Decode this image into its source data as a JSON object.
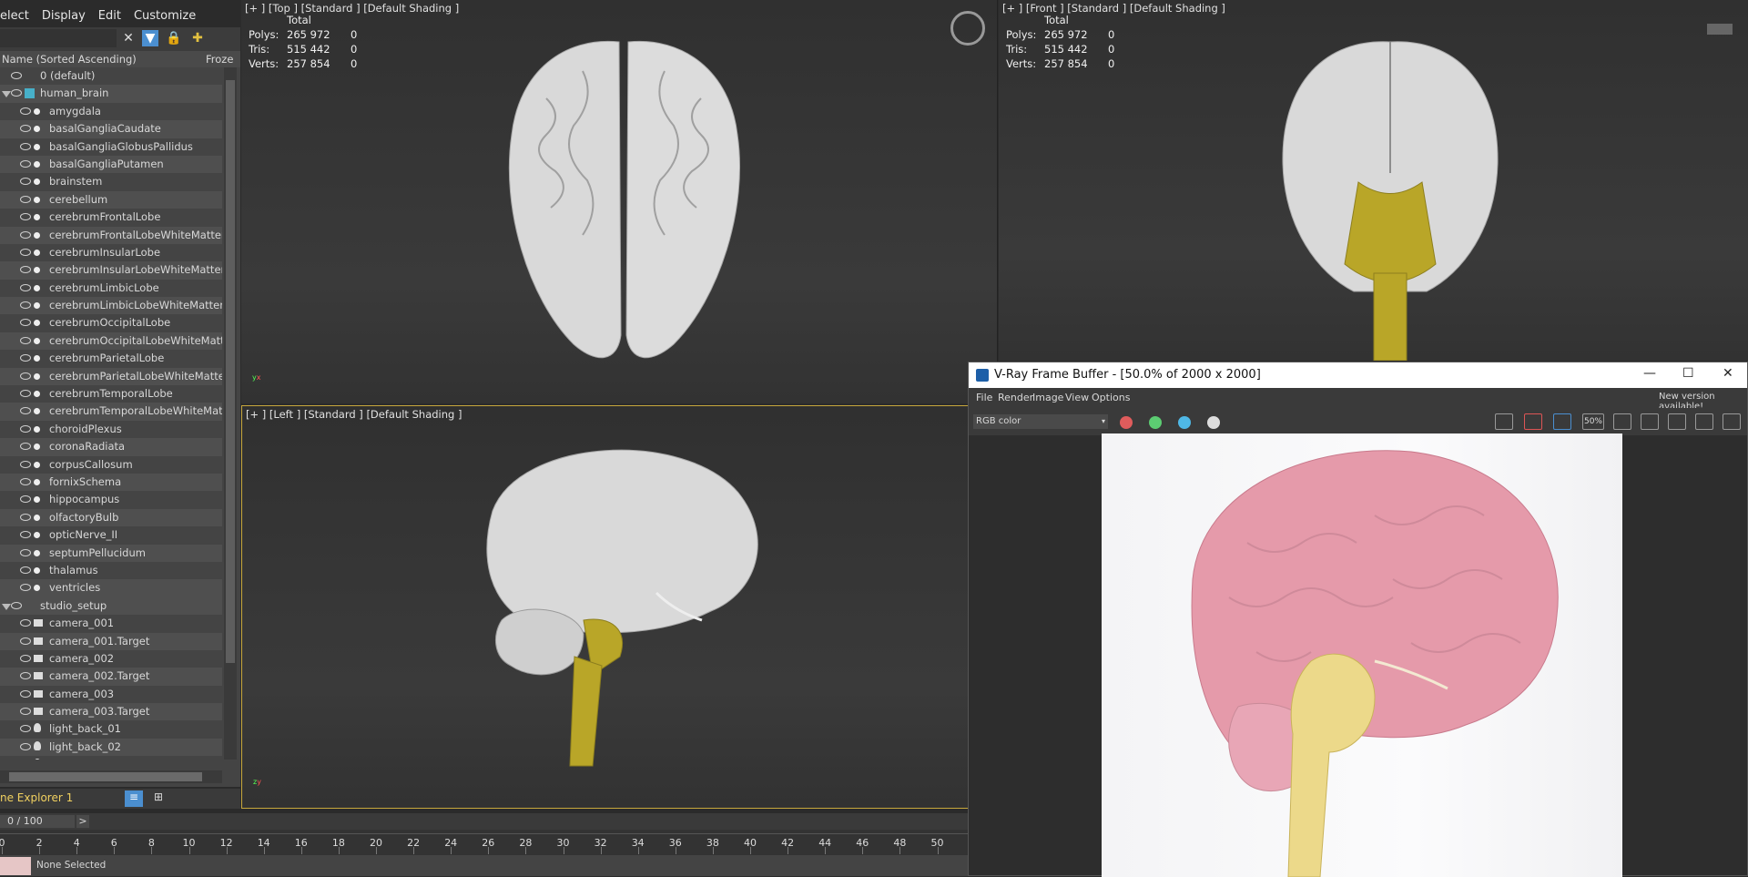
{
  "menu": {
    "items": [
      "elect",
      "Display",
      "Edit",
      "Customize"
    ]
  },
  "explorer": {
    "column_header": "Name (Sorted Ascending)",
    "column_frozen": "Froze",
    "default_layer": "0 (default)",
    "groups": [
      {
        "name": "human_brain",
        "items": [
          "amygdala",
          "basalGangliaCaudate",
          "basalGangliaGlobusPallidus",
          "basalGangliaPutamen",
          "brainstem",
          "cerebellum",
          "cerebrumFrontalLobe",
          "cerebrumFrontalLobeWhiteMatter",
          "cerebrumInsularLobe",
          "cerebrumInsularLobeWhiteMatter",
          "cerebrumLimbicLobe",
          "cerebrumLimbicLobeWhiteMatter",
          "cerebrumOccipitalLobe",
          "cerebrumOccipitalLobeWhiteMatter",
          "cerebrumParietalLobe",
          "cerebrumParietalLobeWhiteMatter",
          "cerebrumTemporalLobe",
          "cerebrumTemporalLobeWhiteMatter",
          "choroidPlexus",
          "coronaRadiata",
          "corpusCallosum",
          "fornixSchema",
          "hippocampus",
          "olfactoryBulb",
          "opticNerve_II",
          "septumPellucidum",
          "thalamus",
          "ventricles"
        ]
      },
      {
        "name": "studio_setup",
        "items": [
          "camera_001",
          "camera_001.Target",
          "camera_002",
          "camera_002.Target",
          "camera_003",
          "camera_003.Target",
          "light_back_01",
          "light_back_02",
          "light_camera"
        ]
      }
    ],
    "footer_label": "ne Explorer 1"
  },
  "viewports": {
    "top": {
      "label": "[+ ]  [Top ]  [Standard ]  [Default Shading ]"
    },
    "front": {
      "label": "[+ ]  [Front ]  [Standard ]  [Default Shading ]"
    },
    "left": {
      "label": "[+ ]  [Left ]  [Standard ]  [Default Shading ]"
    }
  },
  "stats": {
    "total_label": "Total",
    "polys_label": "Polys:",
    "polys_total": "265 972",
    "polys_sel": "0",
    "tris_label": "Tris:",
    "tris_total": "515 442",
    "tris_sel": "0",
    "verts_label": "Verts:",
    "verts_total": "257 854",
    "verts_sel": "0"
  },
  "timeline": {
    "frame_display": "0 / 100",
    "next_label": ">",
    "ticks": [
      "0",
      "2",
      "4",
      "6",
      "8",
      "10",
      "12",
      "14",
      "16",
      "18",
      "20",
      "22",
      "24",
      "26",
      "28",
      "30",
      "32",
      "34",
      "36",
      "38",
      "40",
      "42",
      "44",
      "46",
      "48",
      "50"
    ],
    "status_text": "None Selected"
  },
  "vfb": {
    "title": "V-Ray Frame Buffer - [50.0% of 2000 x 2000]",
    "menu": [
      "File",
      "Render",
      "Image",
      "View",
      "Options"
    ],
    "new_version": "New version available!",
    "channel": "RGB color",
    "zoom_label": "50%",
    "colors": {
      "red": "#e05c5c",
      "green": "#5ccc72",
      "blue": "#4fb8e6"
    }
  },
  "colors": {
    "brain_gray": "#d9d9d9",
    "brainstem_yellow": "#b9a628",
    "render_pink": "#e59aaa",
    "render_yellow": "#ecd98a"
  }
}
